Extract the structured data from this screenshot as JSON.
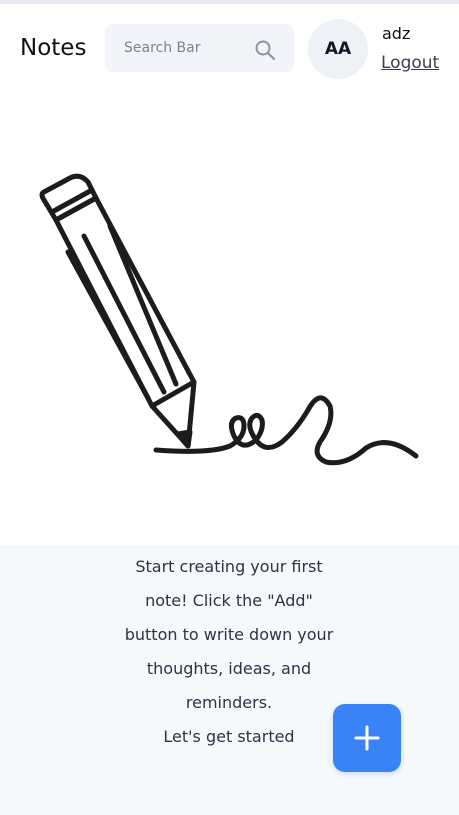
{
  "header": {
    "title": "Notes",
    "search": {
      "placeholder": "Search Bar",
      "value": ""
    },
    "user": {
      "initials": "AA",
      "name": "adz",
      "logout_label": "Logout"
    }
  },
  "empty_state": {
    "message_lines": [
      "Start creating your first",
      "note! Click the \"Add\"",
      "button to write down your",
      "thoughts, ideas, and",
      "reminders.",
      "Let's get started"
    ],
    "illustration_icon": "pencil-writing-icon"
  },
  "actions": {
    "add_icon": "plus-icon"
  },
  "colors": {
    "accent": "#3a82f7",
    "header_bg": "#ffffff",
    "panel_bg": "#f6f9fc"
  }
}
